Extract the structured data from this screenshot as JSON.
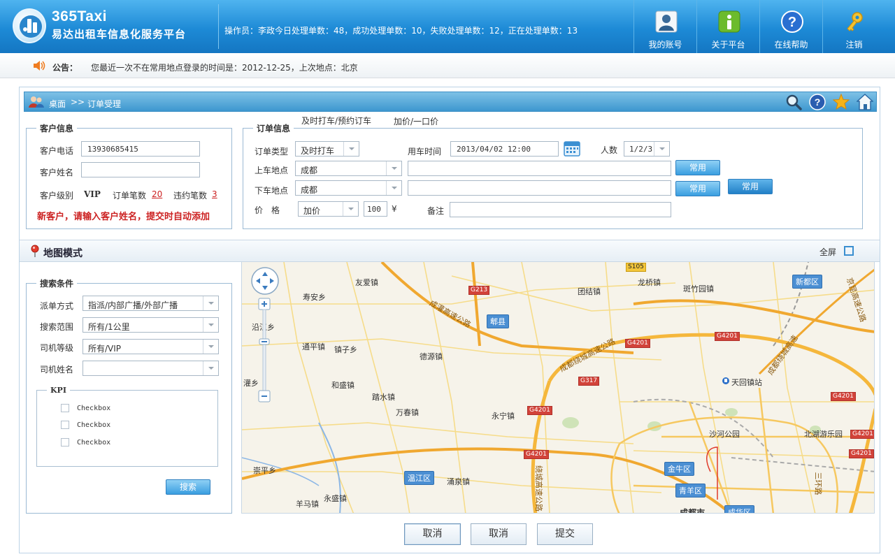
{
  "header": {
    "brand_title": "365Taxi",
    "brand_subtitle": "易达出租车信息化服务平台",
    "operator_stats": "操作员：李政今日处理单数：48，成功处理单数：10，失败处理单数：12，正在处理单数：13",
    "nav": [
      {
        "label": "我的账号",
        "icon": "user-account-icon"
      },
      {
        "label": "关于平台",
        "icon": "info-icon"
      },
      {
        "label": "在线帮助",
        "icon": "help-icon"
      },
      {
        "label": "注销",
        "icon": "key-icon"
      }
    ]
  },
  "notice": {
    "title": "公告：",
    "text": "您最近一次不在常用地点登录的时间是：2012-12-25，上次地点：北京"
  },
  "breadcrumb": {
    "desk": "桌面",
    "sep": ">>",
    "page": "订单受理"
  },
  "customer": {
    "legend": "客户信息",
    "phone_label": "客户电话",
    "phone_value": "13930685415",
    "name_label": "客户姓名",
    "name_value": "",
    "level_label": "客户级别",
    "level_value": "VIP",
    "orders_label": "订单笔数",
    "orders_value": "20",
    "violations_label": "违约笔数",
    "violations_value": "3",
    "new_customer_tip": "新客户，请输入客户姓名，提交时自动添加"
  },
  "order": {
    "legend": "订单信息",
    "tab_instant": "及时打车/预约订车",
    "tab_price": "加价/一口价",
    "type_label": "订单类型",
    "type_value": "及时打车",
    "time_label": "用车时间",
    "time_value": "2013/04/02 12:00",
    "people_label": "人数",
    "people_value": "1/2/3",
    "pickup_label": "上车地点",
    "pickup_city": "成都",
    "pickup_detail": "",
    "dropoff_label": "下车地点",
    "dropoff_city": "成都",
    "dropoff_detail": "",
    "common_button": "常用",
    "common_button2": "常用",
    "common_button3": "常用",
    "price_label": "价　格",
    "price_type": "加价",
    "price_amount": "100",
    "currency": "¥",
    "remark_label": "备注",
    "remark_value": ""
  },
  "map_section": {
    "title": "地图模式",
    "fullscreen": "全屏",
    "labels": [
      {
        "text": "友爱镇"
      },
      {
        "text": "寿安乡"
      },
      {
        "text": "团结镇"
      },
      {
        "text": "龙桥镇"
      },
      {
        "text": "斑竹园镇"
      },
      {
        "text": "新都区"
      },
      {
        "text": "郫县"
      },
      {
        "text": "沿江乡"
      },
      {
        "text": "通平镇"
      },
      {
        "text": "镇子乡"
      },
      {
        "text": "德源镇"
      },
      {
        "text": "成灌高速公路"
      },
      {
        "text": "成都绕城高速公路"
      },
      {
        "text": "天回镇站"
      },
      {
        "text": "灌乡"
      },
      {
        "text": "和盛镇"
      },
      {
        "text": "踏水镇"
      },
      {
        "text": "万春镇"
      },
      {
        "text": "永宁镇"
      },
      {
        "text": "沙河公园"
      },
      {
        "text": "北湖游乐园"
      },
      {
        "text": "崇平乡"
      },
      {
        "text": "温江区"
      },
      {
        "text": "涌泉镇"
      },
      {
        "text": "金牛区"
      },
      {
        "text": "青羊区"
      },
      {
        "text": "羊马镇"
      },
      {
        "text": "永盛镇"
      },
      {
        "text": "成都市"
      },
      {
        "text": "成华区"
      },
      {
        "text": "三环路"
      },
      {
        "text": "京昆高速公路"
      },
      {
        "text": "成都绕城高速"
      },
      {
        "text": "绕城高速公路"
      }
    ],
    "road_tags": [
      "S105",
      "G213",
      "G4201",
      "G4201",
      "G317",
      "G4201",
      "G4201",
      "G4201",
      "G4201",
      "G4201"
    ]
  },
  "search": {
    "legend": "搜索条件",
    "dispatch_label": "派单方式",
    "dispatch_value": "指派/内部广播/外部广播",
    "range_label": "搜索范围",
    "range_value": "所有/1公里",
    "driver_level_label": "司机等级",
    "driver_level_value": "所有/VIP",
    "driver_name_label": "司机姓名",
    "driver_name_value": "",
    "kpi_legend": "KPI",
    "checkboxes": [
      "Checkbox",
      "Checkbox",
      "Checkbox"
    ],
    "search_button": "搜索"
  },
  "footer": {
    "cancel1": "取消",
    "cancel2": "取消",
    "submit": "提交"
  },
  "colors": {
    "header_blue": "#1d8ad6",
    "accent_red": "#cc2222",
    "button_blue": "#3a9ee0"
  }
}
